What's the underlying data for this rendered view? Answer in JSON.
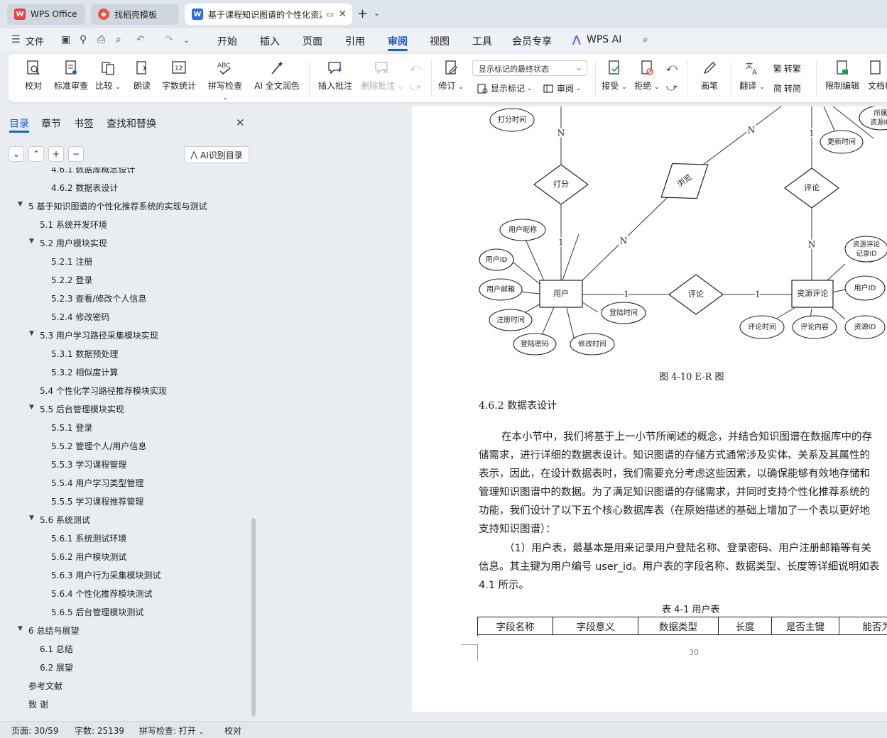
{
  "tabs": [
    {
      "label": "WPS Office"
    },
    {
      "label": "找稻壳模板"
    },
    {
      "label": "基于课程知识图谱的个性化资源推荐系统"
    }
  ],
  "menu": {
    "file": "文件",
    "items": [
      "开始",
      "插入",
      "页面",
      "引用",
      "审阅",
      "视图",
      "工具",
      "会员专享"
    ],
    "active": "审阅",
    "wps_ai": "WPS AI"
  },
  "ribbon": {
    "proofread": "校对",
    "std_review": "标准审查",
    "compare": "比较",
    "read_aloud": "朗读",
    "word_count": "字数统计",
    "spell_check": "拼写检查",
    "ai_polish": "AI 全文润色",
    "insert_comment": "插入批注",
    "delete_comment": "删除批注",
    "track_changes": "修订",
    "track_state": "显示标记的最终状态",
    "show_markup": "显示标记",
    "review": "审阅",
    "accept": "接受",
    "reject": "拒绝",
    "pen": "画笔",
    "translate": "翻译",
    "to_traditional": "转繁",
    "to_simplified": "转简",
    "restrict_edit": "限制编辑",
    "doc_permission": "文档权限"
  },
  "nav": {
    "tabs": [
      "目录",
      "章节",
      "书签",
      "查找和替换"
    ],
    "ai_toc": "AI识别目录",
    "toc": [
      {
        "text": "4.6.1  数据库概念设计",
        "level": 3,
        "caret": false
      },
      {
        "text": "4.6.2  数据表设计",
        "level": 3,
        "caret": false
      },
      {
        "text": "5  基于知识图谱的个性化推荐系统的实现与测试",
        "level": 1,
        "caret": true
      },
      {
        "text": "5.1  系统开发环境",
        "level": 2,
        "caret": false
      },
      {
        "text": "5.2  用户模块实现",
        "level": 2,
        "caret": true
      },
      {
        "text": "5.2.1  注册",
        "level": 3,
        "caret": false
      },
      {
        "text": "5.2.2  登录",
        "level": 3,
        "caret": false
      },
      {
        "text": "5.2.3  查看/修改个人信息",
        "level": 3,
        "caret": false
      },
      {
        "text": "5.2.4  修改密码",
        "level": 3,
        "caret": false
      },
      {
        "text": "5.3  用户学习路径采集模块实现",
        "level": 2,
        "caret": true
      },
      {
        "text": "5.3.1  数据预处理",
        "level": 3,
        "caret": false
      },
      {
        "text": "5.3.2  相似度计算",
        "level": 3,
        "caret": false
      },
      {
        "text": "5.4  个性化学习路径推荐模块实现",
        "level": 2,
        "caret": false
      },
      {
        "text": "5.5  后台管理模块实现",
        "level": 2,
        "caret": true
      },
      {
        "text": "5.5.1  登录",
        "level": 3,
        "caret": false
      },
      {
        "text": "5.5.2  管理个人/用户信息",
        "level": 3,
        "caret": false
      },
      {
        "text": "5.5.3  学习课程管理",
        "level": 3,
        "caret": false
      },
      {
        "text": "5.5.4  用户学习类型管理",
        "level": 3,
        "caret": false
      },
      {
        "text": "5.5.5  学习课程推荐管理",
        "level": 3,
        "caret": false
      },
      {
        "text": "5.6 系统测试",
        "level": 2,
        "caret": true
      },
      {
        "text": "5.6.1  系统测试环境",
        "level": 3,
        "caret": false
      },
      {
        "text": "5.6.2  用户模块测试",
        "level": 3,
        "caret": false
      },
      {
        "text": "5.6.3  用户行为采集模块测试",
        "level": 3,
        "caret": false
      },
      {
        "text": "5.6.4  个性化推荐模块测试",
        "level": 3,
        "caret": false
      },
      {
        "text": "5.6.5  后台管理模块测试",
        "level": 3,
        "caret": false
      },
      {
        "text": "6  总结与展望",
        "level": 1,
        "caret": true
      },
      {
        "text": "6.1  总结",
        "level": 2,
        "caret": false
      },
      {
        "text": "6.2  展望",
        "level": 2,
        "caret": false
      },
      {
        "text": "参考文献",
        "level": 1,
        "caret": false
      },
      {
        "text": "致      谢",
        "level": 1,
        "caret": false
      }
    ]
  },
  "er": {
    "entities": [
      "用户",
      "资源评论"
    ],
    "relations": [
      "打分",
      "浏览",
      "评论",
      "评论"
    ],
    "attributes": [
      "打分时间",
      "所属资源ID",
      "更新时间",
      "用户昵称",
      "用户ID",
      "用户邮箱",
      "注册时间",
      "登陆密码",
      "修改时间",
      "登陆时间",
      "资源评论记录ID",
      "用户ID",
      "评论时间",
      "评论内容",
      "资源ID"
    ],
    "cardinalities": [
      "N",
      "1",
      "N",
      "N",
      "1",
      "1",
      "1",
      "N"
    ]
  },
  "doc": {
    "figure_caption": "图 4-10   E-R 图",
    "section_heading": "4.6.2  数据表设计",
    "paragraph_lines": [
      "在本小节中，我们将基于上一小节所阐述的概念，并结合知识图谱在数据库中的存",
      "储需求，进行详细的数据表设计。知识图谱的存储方式通常涉及实体、关系及其属性的",
      "表示，因此，在设计数据表时，我们需要充分考虑这些因素，以确保能够有效地存储和",
      "管理知识图谱中的数据。为了满足知识图谱的存储需求，并同时支持个性化推荐系统的",
      "功能，我们设计了以下五个核心数据库表（在原始描述的基础上增加了一个表以更好地",
      "支持知识图谱）：",
      "（1）用户表，最基本是用来记录用户登陆名称、登录密码、用户注册邮箱等有关",
      "信息。其主键为用户编号 user_id。用户表的字段名称、数据类型、长度等详细说明如表",
      "4.1 所示。"
    ],
    "table_caption": "表 4-1 用户表",
    "table_headers": [
      "字段名称",
      "字段意义",
      "数据类型",
      "长度",
      "是否主键",
      "能否为空"
    ],
    "page_number": "30"
  },
  "status": {
    "page": "页面: 30/59",
    "words": "字数: 25139",
    "spell": "拼写检查: 打开",
    "proof": "校对"
  },
  "colors": {
    "accent": "#1e5bd6",
    "wps_red": "#e8403a",
    "doc_blue": "#2b6de1"
  }
}
